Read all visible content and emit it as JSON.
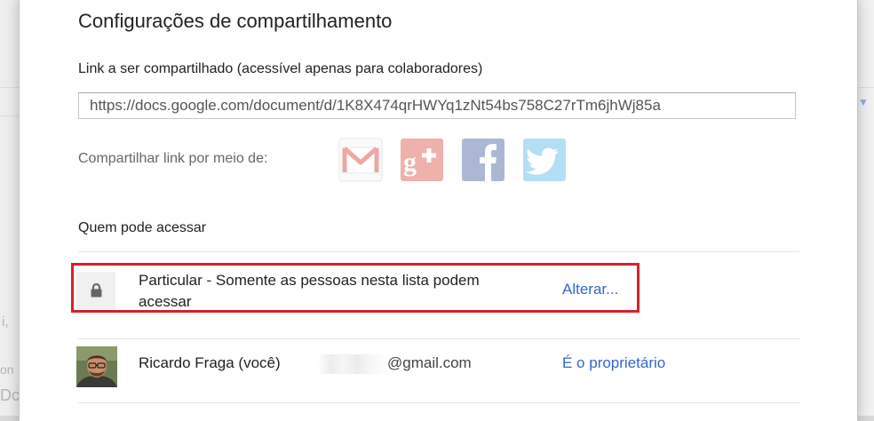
{
  "background": {
    "fragments": [
      "i,",
      "on",
      "Dc"
    ]
  },
  "dialog": {
    "title": "Configurações de compartilhamento",
    "link_label": "Link a ser compartilhado (acessível apenas para colaboradores)",
    "link_url": "https://docs.google.com/document/d/1K8X474qrHWYq1zNt54bs758C27rTm6jhWj85a",
    "share_via_label": "Compartilhar link por meio de:",
    "share_services": [
      {
        "name": "Gmail",
        "icon": "gmail-icon",
        "color": "#d93025"
      },
      {
        "name": "Google+",
        "icon": "google-plus-icon",
        "color": "#d7473a"
      },
      {
        "name": "Facebook",
        "icon": "facebook-icon",
        "color": "#3b5998"
      },
      {
        "name": "Twitter",
        "icon": "twitter-icon",
        "color": "#4fb2e3"
      }
    ],
    "who_has_access_label": "Quem pode acessar",
    "access": {
      "icon": "lock-icon",
      "description": "Particular - Somente as pessoas nesta lista podem acessar",
      "change_label": "Alterar..."
    },
    "owner": {
      "name": "Ricardo Fraga (você)",
      "email_domain": "@gmail.com",
      "role": "É o proprietário"
    },
    "colors": {
      "link": "#3366cc",
      "highlight": "#d6202b"
    }
  }
}
